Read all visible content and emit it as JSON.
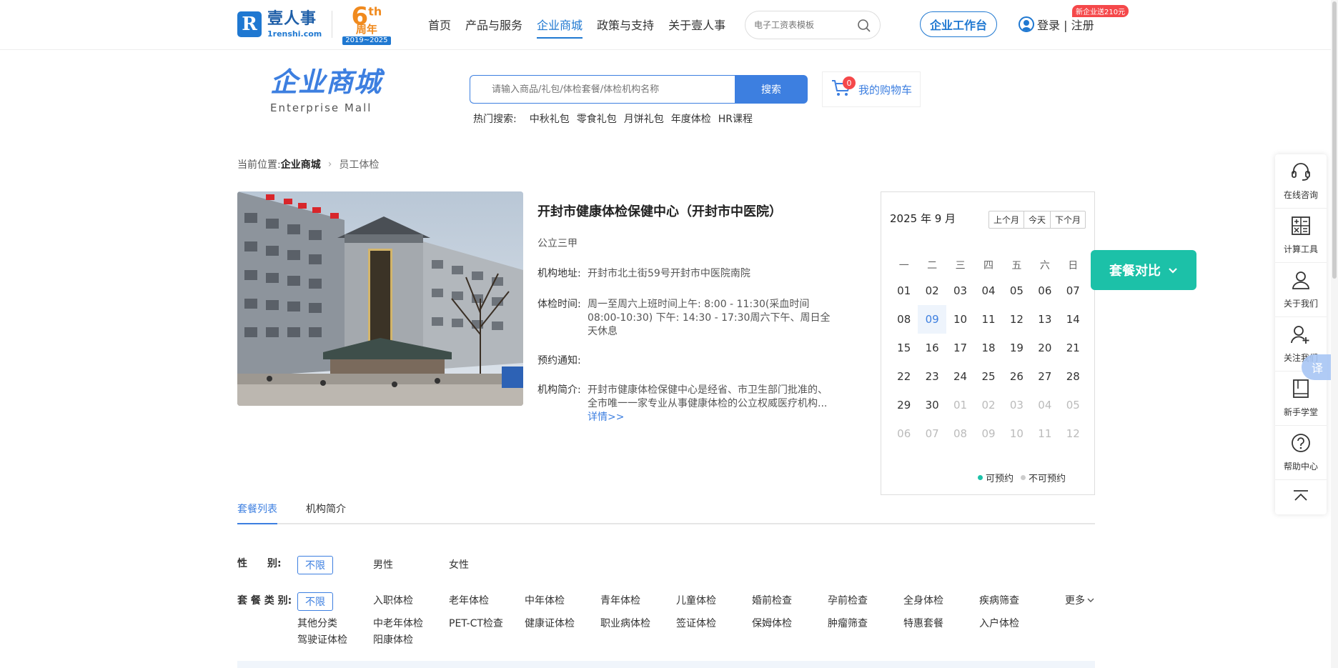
{
  "header": {
    "logo_cn": "壹人事",
    "logo_en": "1renshi.com",
    "anniv_big": "6",
    "anniv_sup": "th",
    "anniv_sub": "周年",
    "anniv_years": "2019~2025",
    "nav": [
      {
        "label": "首页",
        "active": false
      },
      {
        "label": "产品与服务",
        "active": false
      },
      {
        "label": "企业商城",
        "active": true
      },
      {
        "label": "政策与支持",
        "active": false
      },
      {
        "label": "关于壹人事",
        "active": false
      }
    ],
    "search_placeholder": "电子工资表模板",
    "workbench_label": "企业工作台",
    "login_label": "登录 | 注册",
    "promo_badge": "新企业送210元"
  },
  "mall": {
    "title_cn": "企业商城",
    "title_en": "Enterprise  Mall",
    "search_placeholder": "请输入商品/礼包/体检套餐/体检机构名称",
    "search_button": "搜索",
    "cart_label": "我的购物车",
    "cart_count": "0",
    "hot_label": "热门搜索:",
    "hot_items": [
      "中秋礼包",
      "零食礼包",
      "月饼礼包",
      "年度体检",
      "HR课程"
    ]
  },
  "breadcrumb": {
    "prefix": "当前位置:",
    "current": "企业商城",
    "last": "员工体检"
  },
  "hospital": {
    "name": "开封市健康体检保健中心（开封市中医院）",
    "level": "公立三甲",
    "address_key": "机构地址:",
    "address": "开封市北土街59号开封市中医院南院",
    "hours_key": "体检时间:",
    "hours": "周一至周六上班时间上午: 8:00 - 11:30(采血时间08:00-10:30)  下午: 14:30 - 17:30周六下午、周日全天休息",
    "notice_key": "预约通知:",
    "notice": "",
    "intro_key": "机构简介:",
    "intro": "开封市健康体检保健中心是经省、市卫生部门批准的、全市唯一一家专业从事健康体检的公立权威医疗机构...",
    "more_link": "详情>>",
    "sign_text": "开封市中医院"
  },
  "calendar": {
    "title": "2025 年 9 月",
    "buttons": [
      "上个月",
      "今天",
      "下个月"
    ],
    "weekdays": [
      "一",
      "二",
      "三",
      "四",
      "五",
      "六",
      "日"
    ],
    "days": [
      {
        "d": "01"
      },
      {
        "d": "02"
      },
      {
        "d": "03"
      },
      {
        "d": "04"
      },
      {
        "d": "05"
      },
      {
        "d": "06"
      },
      {
        "d": "07"
      },
      {
        "d": "08"
      },
      {
        "d": "09",
        "today": true
      },
      {
        "d": "10"
      },
      {
        "d": "11"
      },
      {
        "d": "12"
      },
      {
        "d": "13"
      },
      {
        "d": "14"
      },
      {
        "d": "15"
      },
      {
        "d": "16"
      },
      {
        "d": "17"
      },
      {
        "d": "18"
      },
      {
        "d": "19"
      },
      {
        "d": "20"
      },
      {
        "d": "21"
      },
      {
        "d": "22"
      },
      {
        "d": "23"
      },
      {
        "d": "24"
      },
      {
        "d": "25"
      },
      {
        "d": "26"
      },
      {
        "d": "27"
      },
      {
        "d": "28"
      },
      {
        "d": "29"
      },
      {
        "d": "30"
      },
      {
        "d": "01",
        "dim": true
      },
      {
        "d": "02",
        "dim": true
      },
      {
        "d": "03",
        "dim": true
      },
      {
        "d": "04",
        "dim": true
      },
      {
        "d": "05",
        "dim": true
      },
      {
        "d": "06",
        "dim": true
      },
      {
        "d": "07",
        "dim": true
      },
      {
        "d": "08",
        "dim": true
      },
      {
        "d": "09",
        "dim": true
      },
      {
        "d": "10",
        "dim": true
      },
      {
        "d": "11",
        "dim": true
      },
      {
        "d": "12",
        "dim": true
      }
    ],
    "legend_available": "可预约",
    "legend_unavailable": "不可预约",
    "color_available": "#1cc1a8",
    "color_unavailable": "#cccccc"
  },
  "compare_button": "套餐对比",
  "tabs": [
    {
      "label": "套餐列表",
      "active": true
    },
    {
      "label": "机构简介",
      "active": false
    }
  ],
  "filters": {
    "gender_label": "性　　别:",
    "gender_selected": "不限",
    "gender_options": [
      "男性",
      "女性"
    ],
    "category_label": "套 餐 类 别:",
    "category_selected": "不限",
    "category_row1": [
      "入职体检",
      "老年体检",
      "中年体检",
      "青年体检",
      "儿童体检",
      "婚前检查",
      "孕前检查",
      "全身体检",
      "疾病筛查"
    ],
    "category_row2": [
      "其他分类",
      "中老年体检",
      "PET-CT检查",
      "健康证体检",
      "职业病体检",
      "签证体检",
      "保姆体检",
      "肿瘤筛查",
      "特惠套餐",
      "入户体检"
    ],
    "category_row3": [
      "驾驶证体检",
      "阳康体检"
    ],
    "more_label": "更多"
  },
  "sidebar": [
    {
      "label": "在线咨询",
      "icon": "headset-icon"
    },
    {
      "label": "计算工具",
      "icon": "calculator-icon"
    },
    {
      "label": "关于我们",
      "icon": "person-icon"
    },
    {
      "label": "关注我们",
      "icon": "person-add-icon"
    },
    {
      "label": "新手学堂",
      "icon": "book-icon"
    },
    {
      "label": "帮助中心",
      "icon": "help-icon"
    }
  ],
  "translate_label": "译",
  "colors": {
    "primary": "#3d7fe0",
    "brand": "#1f78d1",
    "teal": "#1cc1a8",
    "badge": "#f5484a"
  }
}
